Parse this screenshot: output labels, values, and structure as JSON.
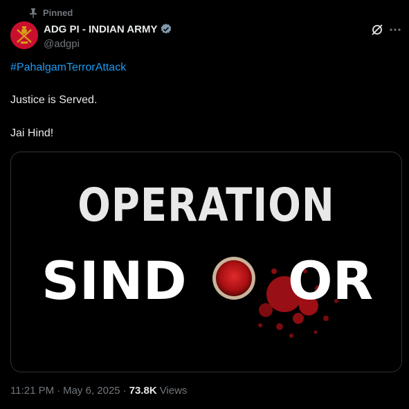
{
  "pinned": {
    "label": "Pinned",
    "icon": "pin-icon"
  },
  "author": {
    "display_name": "ADG PI - INDIAN ARMY",
    "handle": "@adgpi",
    "verified": true,
    "avatar_color": "#c8102e"
  },
  "tweet": {
    "hashtag": "#PahalgamTerrorAttack",
    "line2": "Justice is Served.",
    "line3": "Jai Hind!"
  },
  "media": {
    "line1": "OPERATION",
    "line2_left": "SIND",
    "line2_right": "OR",
    "accent_color": "#c4121a"
  },
  "meta": {
    "time": "11:21 PM",
    "separator1": "·",
    "date": "May 6, 2025",
    "separator2": "·",
    "views_count": "73.8K",
    "views_label": "Views"
  },
  "colors": {
    "background": "#000000",
    "text": "#e7e9ea",
    "secondary": "#71767b",
    "link": "#1d9bf0",
    "border": "#2f3336"
  }
}
